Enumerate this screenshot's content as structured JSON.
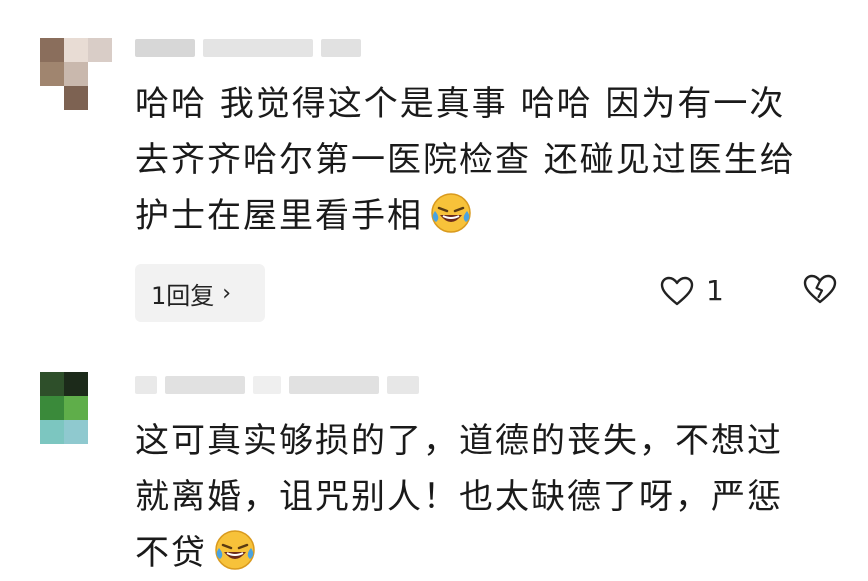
{
  "comments": [
    {
      "username": "",
      "text_lines": [
        "哈哈 我觉得这个是真事 哈哈 因为有一次",
        "去齐齐哈尔第一医院检查 还碰见过医生给",
        "护士在屋里看手相"
      ],
      "emoji": "laughing-crying-emoji",
      "reply_label": "1回复",
      "reply_chevron": "›",
      "like_count": "1",
      "like_icon": "heart-outline-icon",
      "dislike_icon": "broken-heart-icon"
    },
    {
      "username": "",
      "text_lines": [
        "这可真实够损的了，道德的丧失，不想过",
        "就离婚，诅咒别人！也太缺德了呀，严惩",
        "不贷"
      ],
      "emoji": "laughing-crying-emoji"
    }
  ],
  "colors": {
    "background": "#ffffff",
    "text": "#1a1a1a",
    "reply_bg": "#f2f2f2",
    "emoji_face": "#f7c23a",
    "emoji_tear": "#4aa3e0"
  }
}
